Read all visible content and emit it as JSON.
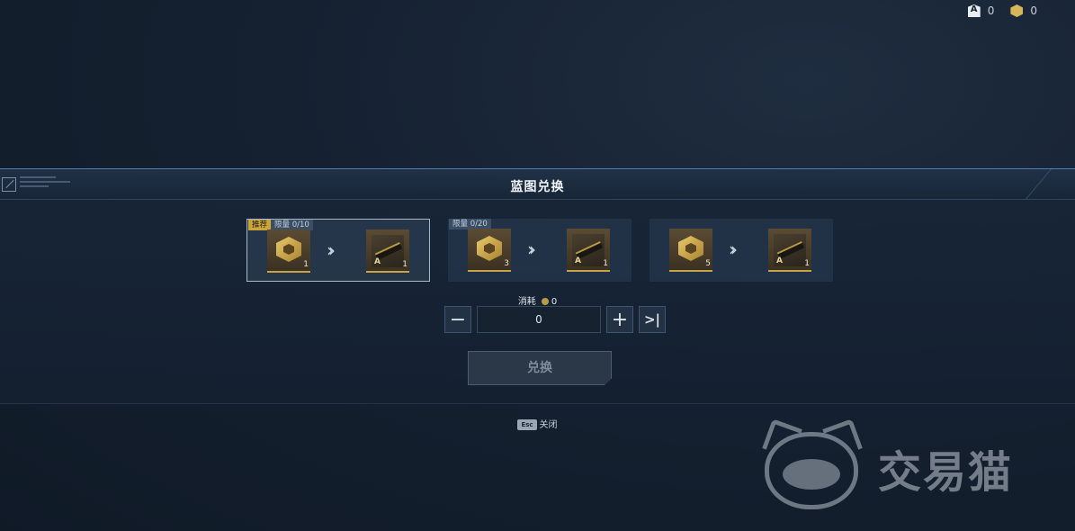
{
  "currency": [
    {
      "icon": "a-coin-icon",
      "value": "0"
    },
    {
      "icon": "blueprint-coin-icon",
      "value": "0"
    }
  ],
  "dialog": {
    "title": "蓝图兑换",
    "options": [
      {
        "tag_recommend": "推荐",
        "tag_limit": "限量 0/10",
        "input_qty": "1",
        "output_qty": "1",
        "selected": true
      },
      {
        "tag_recommend": "",
        "tag_limit": "限量 0/20",
        "input_qty": "3",
        "output_qty": "1",
        "selected": false
      },
      {
        "tag_recommend": "",
        "tag_limit": "",
        "input_qty": "5",
        "output_qty": "1",
        "selected": false
      }
    ],
    "cost_label": "消耗",
    "cost_value": "0",
    "quantity": "0",
    "exchange_label": "兑换",
    "close_key": "Esc",
    "close_label": "关闭"
  },
  "watermark": "交易猫"
}
